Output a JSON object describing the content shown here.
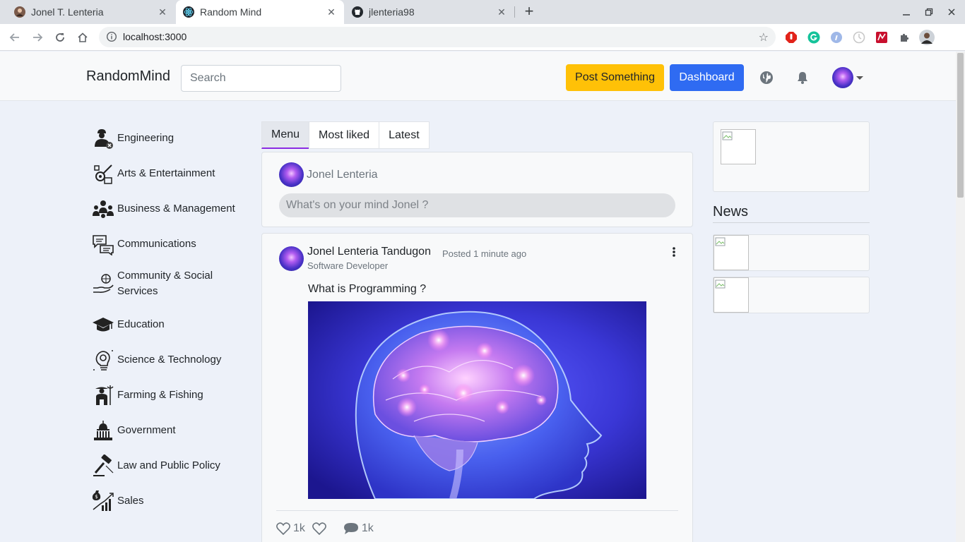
{
  "browser": {
    "tabs": [
      {
        "title": "Jonel T. Lenteria",
        "active": false
      },
      {
        "title": "Random Mind",
        "active": true
      },
      {
        "title": "jlenteria98",
        "active": false
      }
    ],
    "close_glyph": "✕",
    "new_tab_glyph": "+",
    "url": "localhost:3000"
  },
  "header": {
    "brand": "RandomMind",
    "search_placeholder": "Search",
    "post_button": "Post Something",
    "dashboard_button": "Dashboard"
  },
  "sidebar": {
    "categories": [
      {
        "label": "Engineering",
        "icon": "engineer-icon"
      },
      {
        "label": "Arts & Entertainment",
        "icon": "guitar-icon"
      },
      {
        "label": "Business & Management",
        "icon": "team-icon"
      },
      {
        "label": "Communications",
        "icon": "chat-bubbles-icon"
      },
      {
        "label": "Community & Social Services",
        "icon": "hand-globe-icon"
      },
      {
        "label": "Education",
        "icon": "graduation-cap-icon"
      },
      {
        "label": "Science & Technology",
        "icon": "bulb-gear-icon"
      },
      {
        "label": "Farming & Fishing",
        "icon": "farmer-icon"
      },
      {
        "label": "Government",
        "icon": "capitol-icon"
      },
      {
        "label": "Law and Public Policy",
        "icon": "gavel-icon"
      },
      {
        "label": "Sales",
        "icon": "sales-chart-icon"
      }
    ]
  },
  "feed": {
    "tabs": [
      {
        "label": "Menu",
        "active": true
      },
      {
        "label": "Most liked",
        "active": false
      },
      {
        "label": "Latest",
        "active": false
      }
    ],
    "composer": {
      "user_name": "Jonel Lenteria",
      "placeholder": "What's on your mind Jonel ?"
    },
    "post": {
      "author": "Jonel Lenteria Tandugon",
      "posted": "Posted 1 minute ago",
      "role": "Software Developer",
      "question": "What is Programming ?",
      "likes": "1k",
      "comments": "1k"
    }
  },
  "right": {
    "news_title": "News"
  },
  "colors": {
    "post_button": "#ffc107",
    "dashboard_button": "#2f6bf2",
    "active_tab_underline": "#8a2be2"
  }
}
